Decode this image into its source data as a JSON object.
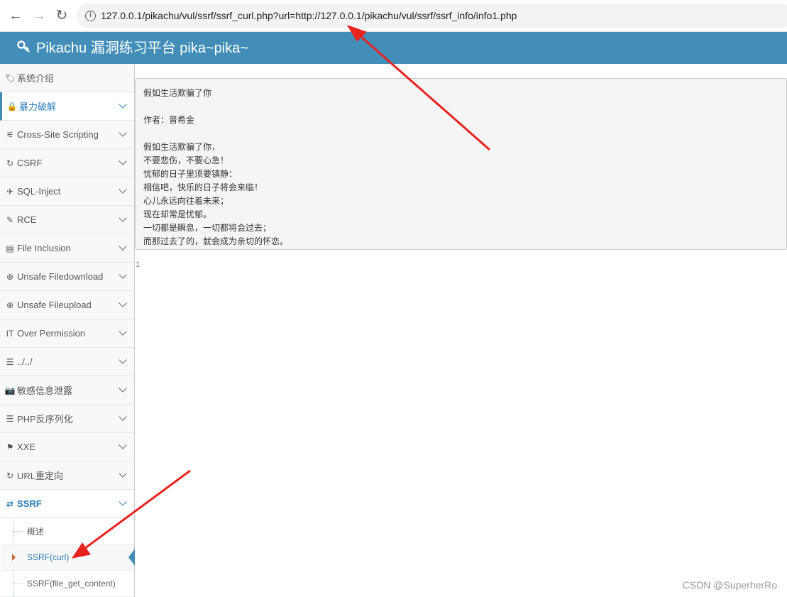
{
  "browser": {
    "back_glyph": "←",
    "forward_glyph": "→",
    "reload_glyph": "↻",
    "url": "127.0.0.1/pikachu/vul/ssrf/ssrf_curl.php?url=http://127.0.0.1/pikachu/vul/ssrf/ssrf_info/info1.php",
    "info_glyph": "i"
  },
  "header": {
    "icon_glyph": "🔍",
    "title": "Pikachu 漏洞练习平台 pika~pika~"
  },
  "sidebar": {
    "items": [
      {
        "icon": "🏷",
        "label": "系统介绍"
      },
      {
        "icon": "🔒",
        "label": "暴力破解"
      },
      {
        "icon": "⚟",
        "label": "Cross-Site Scripting"
      },
      {
        "icon": "↻",
        "label": "CSRF"
      },
      {
        "icon": "✈",
        "label": "SQL-Inject"
      },
      {
        "icon": "✎",
        "label": "RCE"
      },
      {
        "icon": "▤",
        "label": "File Inclusion"
      },
      {
        "icon": "⊕",
        "label": "Unsafe Filedownload"
      },
      {
        "icon": "⊕",
        "label": "Unsafe Fileupload"
      },
      {
        "icon": "IT",
        "label": "Over Permission"
      },
      {
        "icon": "☰",
        "label": "../../"
      },
      {
        "icon": "📷",
        "label": "敏感信息泄露"
      },
      {
        "icon": "☰",
        "label": "PHP反序列化"
      },
      {
        "icon": "⚑",
        "label": "XXE"
      },
      {
        "icon": "↻",
        "label": "URL重定向"
      },
      {
        "icon": "⇄",
        "label": "SSRF"
      }
    ],
    "ssrf_sub": [
      {
        "label": "概述"
      },
      {
        "label": "SSRF(curl)"
      },
      {
        "label": "SSRF(file_get_content)"
      }
    ]
  },
  "content": {
    "poem": "假如生活欺骗了你\n\n作者：普希金\n\n假如生活欺骗了你，\n不要悲伤，不要心急！\n忧郁的日子里须要镇静：\n相信吧，快乐的日子将会来临！\n心儿永远向往着未来；\n现在却常是忧郁。\n一切都是瞬息，一切都将会过去；\n而那过去了的，就会成为亲切的怀恋。",
    "result_number": "1"
  },
  "watermark": "CSDN @SuperherRo",
  "colors": {
    "header_bg": "#438eb9",
    "accent": "#2b7dbc",
    "arrow": "#e8231f"
  }
}
